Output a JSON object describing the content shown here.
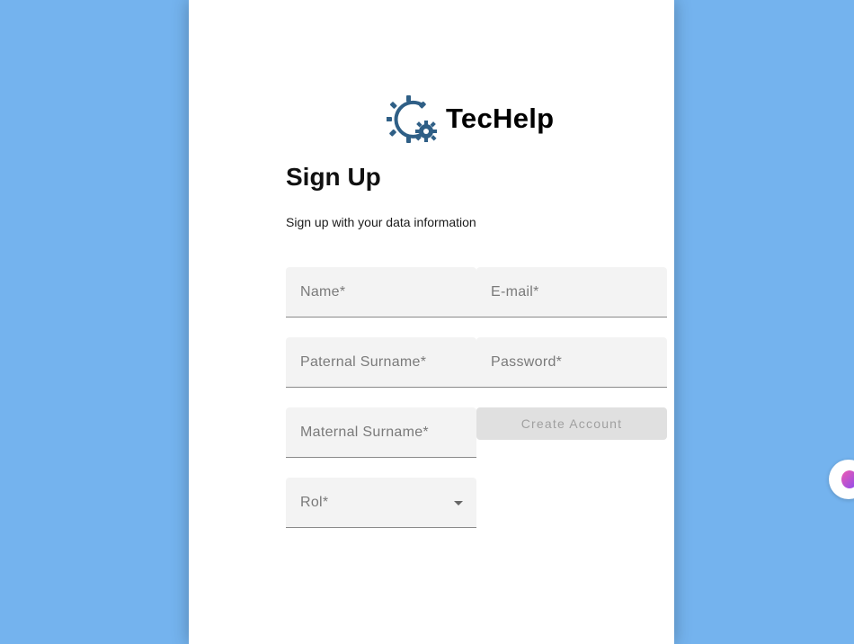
{
  "brand": {
    "name": "TecHelp",
    "logo_icon": "gear-refresh-icon",
    "logo_color": "#2f5f86"
  },
  "page": {
    "title": "Sign Up",
    "subtitle": "Sign up with your data information"
  },
  "form": {
    "name_placeholder": "Name*",
    "email_placeholder": "E-mail*",
    "paternal_surname_placeholder": "Paternal Surname*",
    "password_placeholder": "Password*",
    "maternal_surname_placeholder": "Maternal Surname*",
    "role_label": "Rol*",
    "create_account_label": "Create Account"
  },
  "colors": {
    "background": "#74b3ee",
    "card": "#ffffff",
    "field_bg": "#f3f3f3",
    "button_disabled_bg": "#e0e0e0"
  },
  "floating_widget": {
    "icon": "brain-extension-icon"
  }
}
